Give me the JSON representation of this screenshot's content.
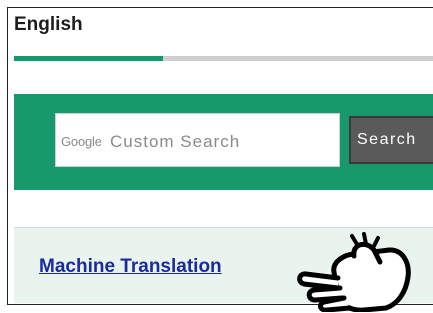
{
  "header": {
    "title": "English"
  },
  "progress": {
    "value_percent": 35
  },
  "search": {
    "brand": "Google",
    "placeholder": "Custom Search",
    "button_label": "Search"
  },
  "machine_translation": {
    "link_text": "Machine Translation"
  },
  "icons": {
    "pointer": "pointing-hand-icon"
  },
  "colors": {
    "accent_green": "#17996b",
    "link_blue": "#1a2aa0",
    "panel_bg": "#eaf4ef",
    "button_gray": "#5a5a5a"
  }
}
